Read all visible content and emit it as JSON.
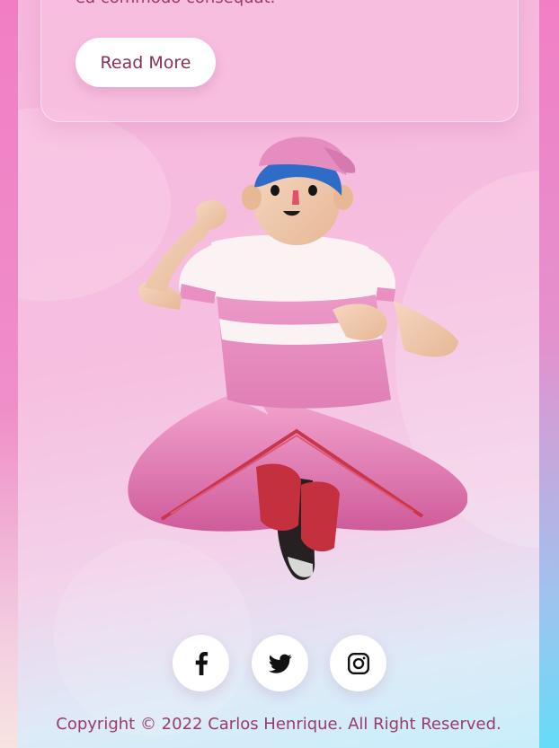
{
  "card": {
    "text": "ea commodo consequat.",
    "button_label": "Read More"
  },
  "illustration": {
    "icon": "jumping-character-illustration"
  },
  "social": [
    {
      "name": "facebook",
      "icon": "facebook-icon"
    },
    {
      "name": "twitter",
      "icon": "twitter-icon"
    },
    {
      "name": "instagram",
      "icon": "instagram-icon"
    }
  ],
  "footer": {
    "copyright": "Copyright © 2022 Carlos Henrique. All Right Reserved."
  },
  "colors": {
    "accent_text": "#9a3b6b",
    "background_pink": "#f17ec4",
    "background_cyan": "#66dcf8",
    "card": "#f8bee1"
  }
}
